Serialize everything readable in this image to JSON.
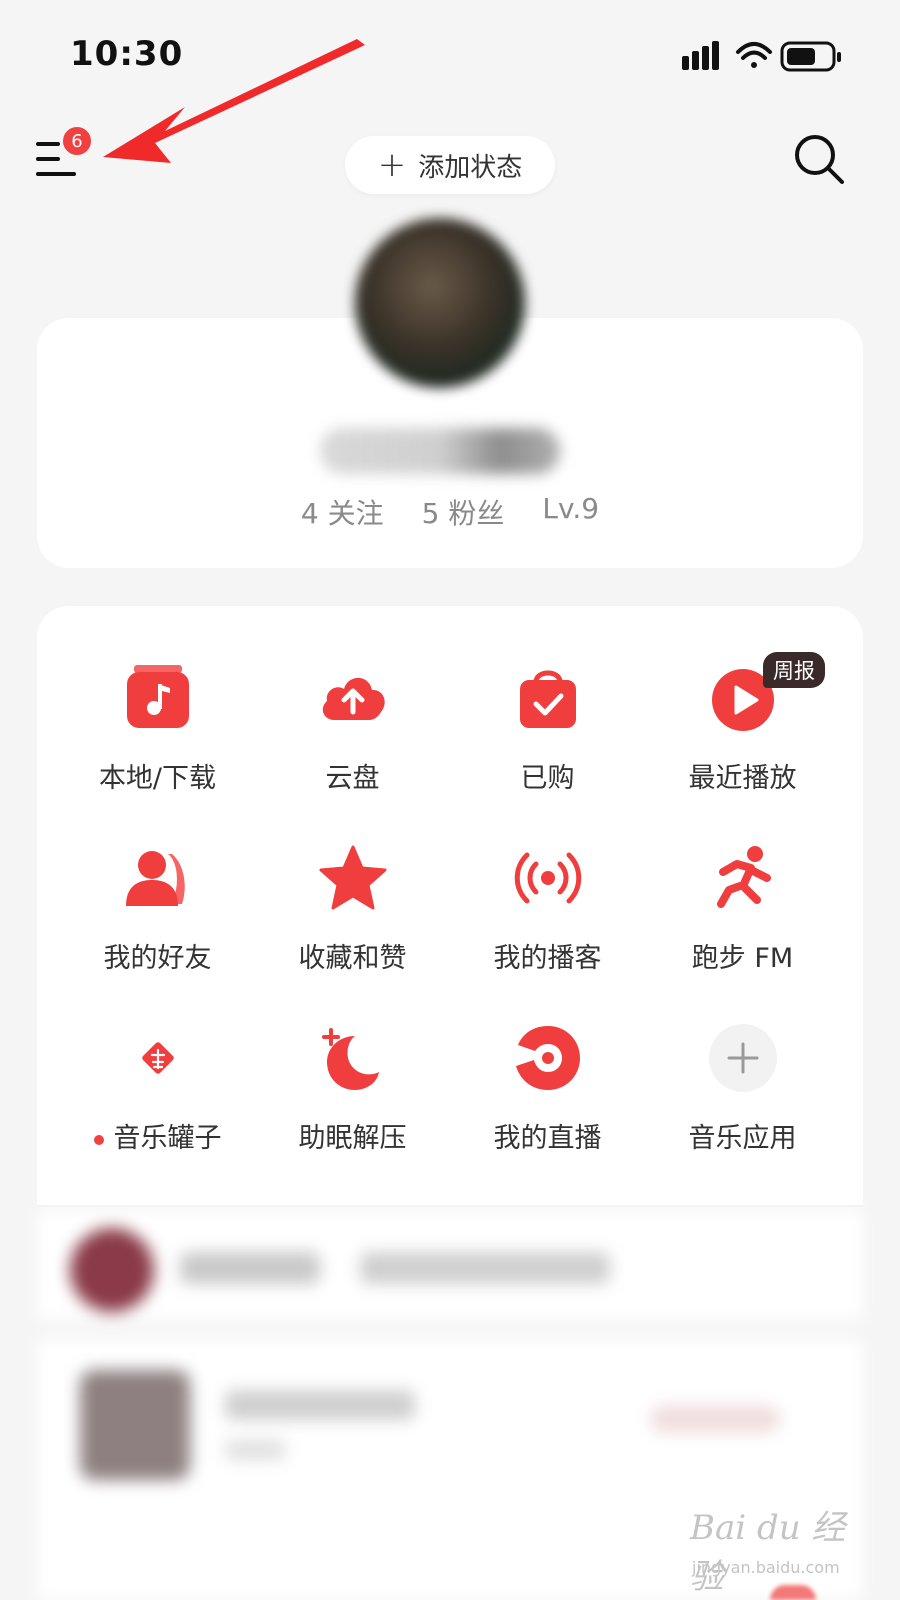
{
  "status_bar": {
    "time": "10:30"
  },
  "header": {
    "menu_badge": "6",
    "status_button_plus": "+",
    "status_button_label": "添加状态"
  },
  "profile": {
    "stats": [
      {
        "label": "4 关注"
      },
      {
        "label": "5 粉丝"
      },
      {
        "label": "Lv.9"
      }
    ]
  },
  "features": {
    "items": [
      {
        "label": "本地/下载",
        "icon": "music-folder-icon"
      },
      {
        "label": "云盘",
        "icon": "cloud-upload-icon"
      },
      {
        "label": "已购",
        "icon": "shopping-bag-icon"
      },
      {
        "label": "最近播放",
        "icon": "play-circle-icon",
        "tag": "周报"
      },
      {
        "label": "我的好友",
        "icon": "friends-icon"
      },
      {
        "label": "收藏和赞",
        "icon": "star-icon"
      },
      {
        "label": "我的播客",
        "icon": "podcast-icon"
      },
      {
        "label": "跑步 FM",
        "icon": "runner-icon"
      },
      {
        "label": "音乐罐子",
        "icon": "fu-icon",
        "has_dot": true
      },
      {
        "label": "助眠解压",
        "icon": "moon-icon"
      },
      {
        "label": "我的直播",
        "icon": "live-icon"
      },
      {
        "label": "音乐应用",
        "icon": "add-app-icon"
      }
    ]
  },
  "watermark": {
    "main": "Bai du 经验",
    "sub": "jingyan.baidu.com"
  },
  "colors": {
    "accent": "#f04040",
    "background": "#f5f5f5",
    "card": "#ffffff",
    "muted_text": "#8a8a8a"
  }
}
